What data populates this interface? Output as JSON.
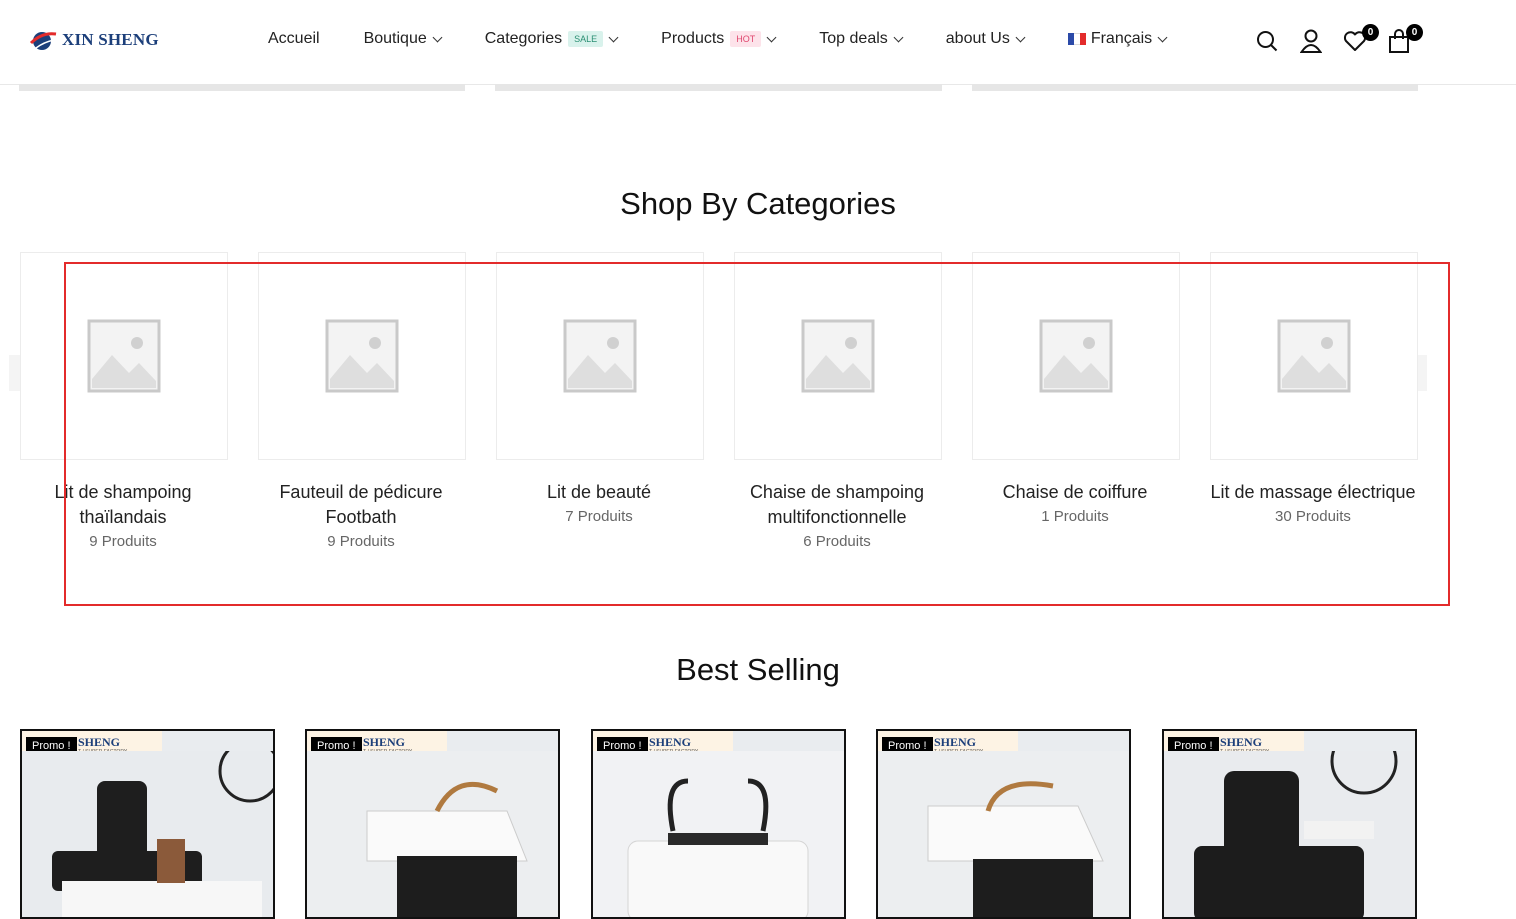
{
  "header": {
    "logo_text": "XIN SHENG",
    "nav": [
      {
        "label": "Accueil",
        "dropdown": false
      },
      {
        "label": "Boutique",
        "dropdown": true
      },
      {
        "label": "Categories",
        "badge": "SALE",
        "dropdown": true
      },
      {
        "label": "Products",
        "badge": "HOT",
        "dropdown": true
      },
      {
        "label": "Top deals",
        "dropdown": true
      },
      {
        "label": "about Us",
        "dropdown": true
      },
      {
        "label": "Français",
        "dropdown": true
      }
    ],
    "wishlist_count": "0",
    "cart_count": "0"
  },
  "categories_section": {
    "title": "Shop By Categories",
    "items": [
      {
        "name_line1": "Lit de shampoing",
        "name_line2": "thaïlandais",
        "count": "9 Produits"
      },
      {
        "name_line1": "Fauteuil de pédicure",
        "name_line2": "Footbath",
        "count": "9 Produits"
      },
      {
        "name_line1": "Lit de beauté",
        "name_line2": "",
        "count": "7 Produits"
      },
      {
        "name_line1": "Chaise de shampoing",
        "name_line2": "multifonctionnelle",
        "count": "6 Produits"
      },
      {
        "name_line1": "Chaise de coiffure",
        "name_line2": "",
        "count": "1 Produits"
      },
      {
        "name_line1": "Lit de massage électrique",
        "name_line2": "",
        "count": "30 Produits"
      }
    ]
  },
  "best_selling": {
    "title": "Best Selling",
    "products": [
      {
        "badge": "Promo !",
        "brand": "SHENG",
        "sub": "T / SUPER FACTORY"
      },
      {
        "badge": "Promo !",
        "brand": "SHENG",
        "sub": "T / SUPER FACTORY"
      },
      {
        "badge": "Promo !",
        "brand": "SHENG",
        "sub": "T / SUPER FACTORY"
      },
      {
        "badge": "Promo !",
        "brand": "SHENG",
        "sub": "T / SUPER FACTORY"
      },
      {
        "badge": "Promo !",
        "brand": "SHENG",
        "sub": "T / SUPER FACTORY"
      }
    ]
  },
  "colors": {
    "highlight": "#e32b2b",
    "brand": "#1c3f7a",
    "sale": "#2b8f73",
    "hot": "#e0486f"
  }
}
